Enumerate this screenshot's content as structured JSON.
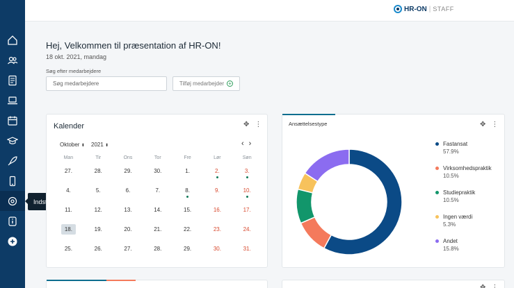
{
  "header": {
    "logo_text": "HR-ON",
    "logo_sep": "|",
    "logo_product": "STAFF"
  },
  "sidebar": {
    "items": [
      {
        "name": "home-icon"
      },
      {
        "name": "users-icon"
      },
      {
        "name": "document-icon"
      },
      {
        "name": "laptop-icon"
      },
      {
        "name": "calendar-icon"
      },
      {
        "name": "graduation-cap-icon"
      },
      {
        "name": "rocket-icon"
      },
      {
        "name": "phone-icon"
      },
      {
        "name": "settings-icon"
      },
      {
        "name": "info-icon"
      },
      {
        "name": "add-circle-icon"
      }
    ],
    "tooltip": "Indstillinger"
  },
  "main": {
    "welcome": "Hej, Velkommen til præsentation af HR-ON!",
    "date": "18 okt. 2021, mandag",
    "search_label": "Søg efter medarbejdere",
    "search_placeholder": "Søg medarbejdere",
    "add_button": "Tilføj medarbejder"
  },
  "calendar": {
    "title": "Kalender",
    "month": "Oktober",
    "year": "2021",
    "weekdays": [
      "Man",
      "Tir",
      "Ons",
      "Tor",
      "Fre",
      "Lør",
      "Søn"
    ],
    "weeks": [
      [
        "27.",
        "28.",
        "29.",
        "30.",
        "1.",
        "2.",
        "3."
      ],
      [
        "4.",
        "5.",
        "6.",
        "7.",
        "8.",
        "9.",
        "10."
      ],
      [
        "11.",
        "12.",
        "13.",
        "14.",
        "15.",
        "16.",
        "17."
      ],
      [
        "18.",
        "19.",
        "20.",
        "21.",
        "22.",
        "23.",
        "24."
      ],
      [
        "25.",
        "26.",
        "27.",
        "28.",
        "29.",
        "30.",
        "31."
      ]
    ]
  },
  "employment_chart": {
    "title": "Ansættelsestype"
  },
  "chart_data": {
    "type": "pie",
    "title": "Ansættelsestype",
    "categories": [
      "Fastansat",
      "Virksomhedspraktik",
      "Studiepraktik",
      "Ingen værdi",
      "Andet"
    ],
    "values": [
      57.9,
      10.5,
      10.5,
      5.3,
      15.8
    ],
    "labels": [
      "57.9%",
      "10.5%",
      "10.5%",
      "5.3%",
      "15.8%"
    ],
    "colors": [
      "#0b4a86",
      "#f47a5c",
      "#12966b",
      "#f7c25c",
      "#8b6cf0"
    ],
    "legend": "right"
  }
}
